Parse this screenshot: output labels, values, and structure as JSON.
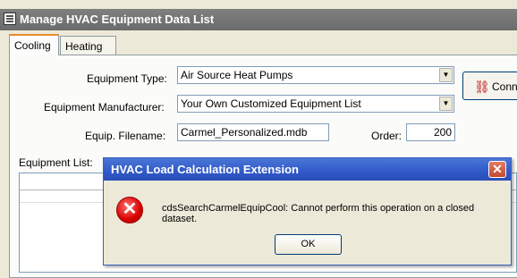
{
  "window": {
    "title": "Manage HVAC Equipment Data List"
  },
  "tabs": [
    {
      "label": "Cooling",
      "active": true
    },
    {
      "label": "Heating",
      "active": false
    }
  ],
  "form": {
    "equipment_type": {
      "label": "Equipment Type:",
      "value": "Air Source Heat Pumps"
    },
    "manufacturer": {
      "label": "Equipment Manufacturer:",
      "value": "Your Own Customized Equipment List"
    },
    "filename": {
      "label": "Equip. Filename:",
      "value": "Carmel_Personalized.mdb"
    },
    "order": {
      "label": "Order:",
      "value": "200"
    },
    "equipment_list_label": "Equipment List:"
  },
  "side_button": {
    "label": "Conn"
  },
  "dialog": {
    "title": "HVAC Load Calculation Extension",
    "message": "cdsSearchCarmelEquipCool: Cannot perform this operation on a closed dataset.",
    "ok_label": "OK",
    "close_glyph": "✕",
    "error_glyph": "✕"
  },
  "icons": {
    "error": "error-icon",
    "app": "app-icon",
    "dropdown": "chevron-down-icon"
  },
  "colors": {
    "dialog_title": "#3159c8",
    "tab_accent": "#e68b2c",
    "error": "#d80000"
  }
}
